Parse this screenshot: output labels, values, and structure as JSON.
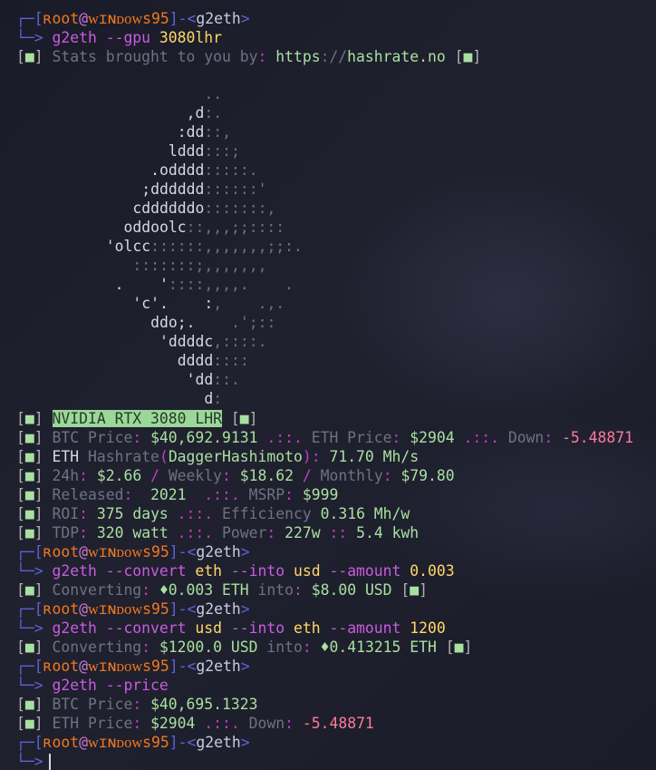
{
  "prompt": {
    "user": "ʀoot",
    "at": "@",
    "host": "ᴡɪɴᴅᴏᴡs95",
    "cwd": "g2eth"
  },
  "commands": [
    {
      "name": "g2eth",
      "args": [
        [
          "--gpu",
          "flag"
        ],
        [
          "3080lhr",
          "num"
        ]
      ]
    },
    {
      "name": "g2eth",
      "args": [
        [
          "--convert",
          "flag"
        ],
        [
          "eth",
          "arg"
        ],
        [
          "--into",
          "flag"
        ],
        [
          "usd",
          "arg"
        ],
        [
          "--amount",
          "flag"
        ],
        [
          "0.003",
          "num"
        ]
      ]
    },
    {
      "name": "g2eth",
      "args": [
        [
          "--convert",
          "flag"
        ],
        [
          "usd",
          "arg"
        ],
        [
          "--into",
          "flag"
        ],
        [
          "eth",
          "arg"
        ],
        [
          "--amount",
          "flag"
        ],
        [
          "1200",
          "num"
        ]
      ]
    },
    {
      "name": "g2eth",
      "args": [
        [
          "--price",
          "flag"
        ]
      ]
    }
  ],
  "stats_credit": {
    "label": "Stats brought to you by",
    "url_scheme": "https",
    "url_rest": "hashrate.no"
  },
  "ascii_art": [
    [
      "                    ",
      ".."
    ],
    [
      "                  ,d",
      ":."
    ],
    [
      "                 :dd",
      "::,"
    ],
    [
      "                lddd",
      ":::;"
    ],
    [
      "              .odddd",
      ":::::."
    ],
    [
      "             ;dddddd",
      "::::::'"
    ],
    [
      "            cddddddo",
      ":::::::,"
    ],
    [
      "           oddoolc",
      "::,,,;;::::"
    ],
    [
      "         'olcc",
      "::::::,,,,,,,;;:."
    ],
    [
      "            ",
      ":::::::;,,,,,,,"
    ],
    [
      "          .    '",
      "::::,,,,.    ."
    ],
    [
      "            'c'.    :",
      ",    .,."
    ],
    [
      "              ddo;.",
      "    .';::"
    ],
    [
      "               'ddddc",
      ",::::."
    ],
    [
      "                 dddd",
      "::::"
    ],
    [
      "                  'dd",
      "::."
    ],
    [
      "                    d",
      ":"
    ]
  ],
  "gpu": {
    "name": "NVIDIA RTX 3080 LHR",
    "btc_label": "BTC Price",
    "btc_price": "$40,692.9131",
    "eth_label": "ETH Price",
    "eth_price": "$2904",
    "down_label": "Down",
    "down_value": "-5.48871",
    "hashrate_label_a": "ETH",
    "hashrate_label_b": "Hashrate",
    "algo": "DaggerHashimoto",
    "hashrate": "71.70 Mh/s",
    "daily_label": "24h",
    "daily": "$2.66",
    "weekly_label": "Weekly",
    "weekly": "$18.62",
    "monthly_label": "Monthly",
    "monthly": "$79.80",
    "released_label": "Released",
    "released": "2021",
    "msrp_label": "MSRP",
    "msrp": "$999",
    "roi_label": "ROI",
    "roi": "375 days",
    "eff_label": "Efficiency",
    "eff": "0.316 Mh/w",
    "tdp_label": "TDP",
    "tdp": "320 watt",
    "power_label": "Power",
    "power": "227w",
    "kwh": "5.4 kwh"
  },
  "conversions": [
    {
      "label": "Converting",
      "from": "♦0.003 ETH",
      "into": "into",
      "to": "$8.00 USD"
    },
    {
      "label": "Converting",
      "from": "$1200.0 USD",
      "into": "into",
      "to": "♦0.413215 ETH"
    }
  ],
  "price": {
    "btc_label": "BTC Price",
    "btc_price": "$40,695.1323",
    "eth_label": "ETH Price",
    "eth_price": "$2904",
    "down_label": "Down",
    "down_value": "-5.48871"
  },
  "box_char": "■",
  "sep": ".::.",
  "colors": {
    "background": "#1b1c2a",
    "frame": "#5c63d6",
    "user": "#f0781e",
    "command": "#c85ce0",
    "value": "#a8e0a0",
    "accent": "#ffd86a"
  }
}
